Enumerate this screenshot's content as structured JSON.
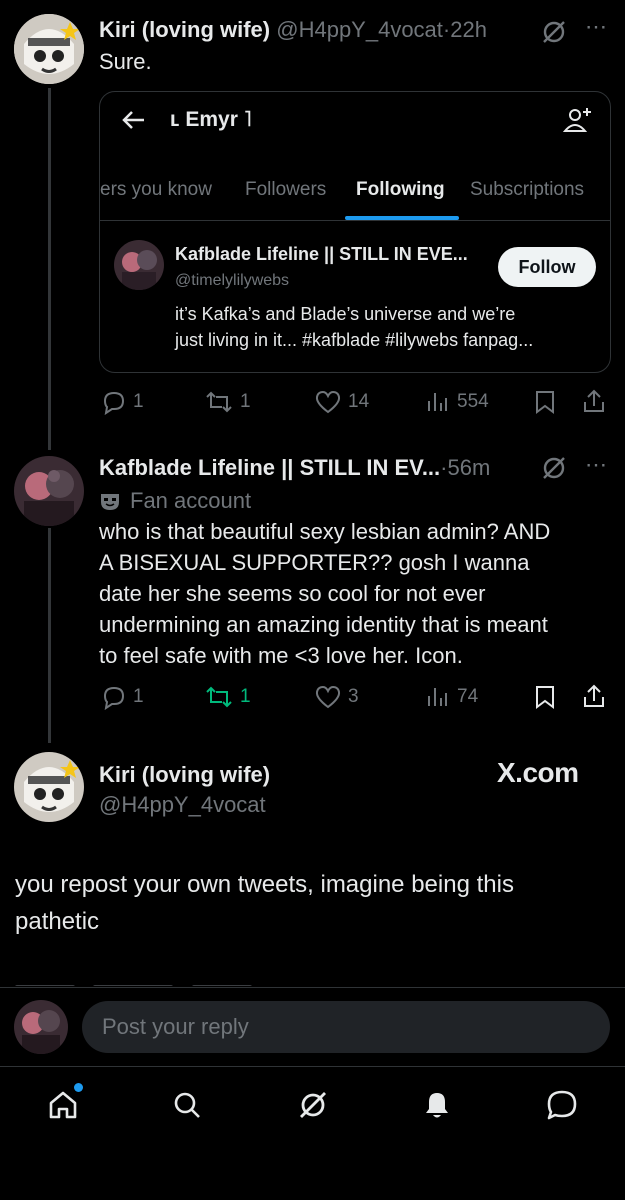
{
  "post1": {
    "name": "Kiri (loving wife)",
    "handle": "@H4ppY_4vocat",
    "dot": "·",
    "time": "22h",
    "text": "Sure.",
    "embed": {
      "title": "ʟ Emyr ˥",
      "tabs": [
        "ers you know",
        "Followers",
        "Following",
        "Subscriptions"
      ],
      "active_tab": "Following",
      "account": {
        "name": "Kafblade Lifeline || STILL IN EVE...",
        "handle": "@timelylilywebs",
        "bio_line1": "it’s Kafka’s and Blade’s universe and we’re",
        "bio_line2": "just living in it... #kafblade #lilywebs fanpag...",
        "follow_label": "Follow"
      }
    },
    "stats": {
      "replies": "1",
      "reposts": "1",
      "likes": "14",
      "views": "554"
    }
  },
  "post2": {
    "name": "Kafblade Lifeline || STILL IN EV...",
    "dot": "·",
    "time": "56m",
    "badge": "Fan account",
    "lines": [
      "who is that beautiful sexy lesbian admin? AND",
      "A BISEXUAL SUPPORTER??  gosh I wanna",
      "date her she seems so cool for not ever",
      "undermining an amazing identity that is meant",
      "to feel safe with me <3 love her. Icon."
    ],
    "stats": {
      "replies": "1",
      "reposts": "1",
      "likes": "3",
      "views": "74"
    }
  },
  "main_post": {
    "name": "Kiri (loving wife)",
    "handle": "@H4ppY_4vocat",
    "source": "X.com",
    "line1": "you repost your own tweets, imagine being this",
    "line2": "pathetic"
  },
  "reply": {
    "placeholder": "Post your reply"
  },
  "nav": [
    "home-icon",
    "search-icon",
    "grok-icon",
    "bell-icon",
    "messages-icon"
  ],
  "colors": {
    "accent": "#1d9bf0",
    "repost_active": "#00ba7c",
    "background": "#000000"
  }
}
